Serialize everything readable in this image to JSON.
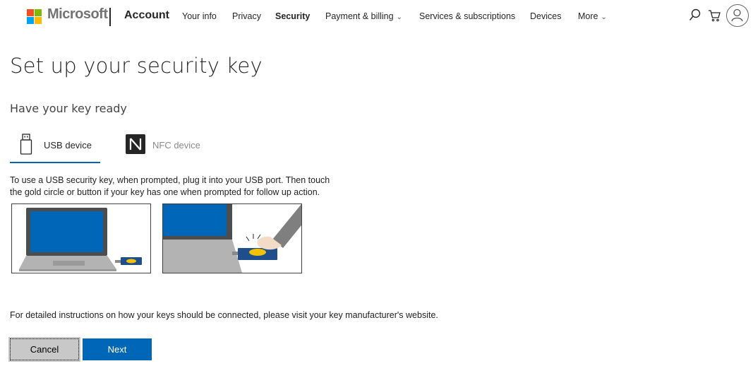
{
  "header": {
    "brand": "Microsoft",
    "section": "Account",
    "nav": [
      {
        "label": "Your info"
      },
      {
        "label": "Privacy"
      },
      {
        "label": "Security"
      },
      {
        "label": "Payment & billing"
      },
      {
        "label": "Services & subscriptions"
      },
      {
        "label": "Devices"
      },
      {
        "label": "More"
      }
    ],
    "active_nav": "Security",
    "icons": [
      "search-icon",
      "cart-icon",
      "avatar-icon"
    ]
  },
  "colors": {
    "accent": "#0067b8",
    "logo_red": "#f25022",
    "logo_green": "#7fba00",
    "logo_blue": "#00a4ef",
    "logo_yellow": "#ffb900"
  },
  "main": {
    "title": "Set up your security key",
    "subtitle": "Have your key ready",
    "tabs": [
      {
        "label": "USB device",
        "icon": "usb-icon",
        "selected": true
      },
      {
        "label": "NFC device",
        "icon": "nfc-icon",
        "selected": false
      }
    ],
    "instructions_line1": "To use a USB security key, when prompted, plug it into your USB port. Then touch",
    "instructions_line2": "the gold circle or button if your key has one when prompted for follow up action.",
    "detail": "For detailed instructions on how your keys should be connected, please visit your key manufacturer's website.",
    "cancel_label": "Cancel",
    "next_label": "Next"
  }
}
